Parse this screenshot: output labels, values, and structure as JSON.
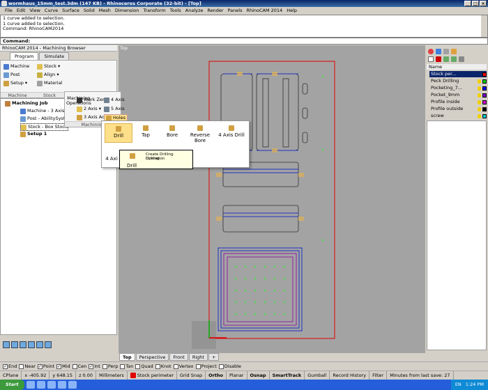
{
  "window": {
    "title": "wormhaus_15mm_test.3dm (147 KB) - Rhinoceros Corporate (32-bit) - [Top]"
  },
  "menu": [
    "File",
    "Edit",
    "View",
    "Curve",
    "Surface",
    "Solid",
    "Mesh",
    "Dimension",
    "Transform",
    "Tools",
    "Analyze",
    "Render",
    "Panels",
    "RhinoCAM 2014",
    "Help"
  ],
  "history": [
    "1 curve added to selection.",
    "1 curve added to selection.",
    "Command: RhinoCAM2014"
  ],
  "command": {
    "label": "Command:"
  },
  "browser": {
    "title": "RhinoCAM 2014 - Machining Browser",
    "tabs": [
      "Program",
      "Simulate"
    ],
    "ribbon": {
      "machine": "Machine",
      "post": "Post",
      "setup": "Setup",
      "stock": "Stock",
      "align": "Align",
      "material": "Material",
      "machining_operations": "Machining Operations",
      "work_zero": "Work Zero",
      "two_axis": "2 Axis",
      "three_axis_adv": "3 Axis Adv",
      "four_axis": "4 Axis",
      "five_axis": "5 Axis",
      "holes": "Holes",
      "group_machine_setup": "Machine Setup",
      "group_stock": "Stock",
      "group_machining": "Machining"
    },
    "tree": {
      "job": "Machining Job",
      "machine": "Machine - 3 Axis",
      "post": "Post - AbilitySyste",
      "stock": "Stock - Box Stock",
      "setup": "Setup 1"
    }
  },
  "viewport": {
    "label": "Top"
  },
  "holes_menu": {
    "items": [
      "Drill",
      "Tap",
      "Bore",
      "Reverse Bore",
      "4 Axis Drill"
    ],
    "row2_partial": "4 Axi",
    "tooltip": {
      "title": "Create Drilling Operation",
      "subtitle": "Drilling",
      "name": "Drill"
    }
  },
  "layers": {
    "header": "Name",
    "items": [
      {
        "name": "Stock per...",
        "color": "#ff0000",
        "selected": true
      },
      {
        "name": "Peck Drilling",
        "color": "#00cc00"
      },
      {
        "name": "Pocketing_7...",
        "color": "#0000ff"
      },
      {
        "name": "Pocket_9mm",
        "color": "#7700cc"
      },
      {
        "name": "Profile inside",
        "color": "#cc00cc"
      },
      {
        "name": "Profile outside",
        "color": "#000000"
      },
      {
        "name": "screw",
        "color": "#00cccc"
      }
    ]
  },
  "viewtabs": [
    "Top",
    "Perspective",
    "Front",
    "Right"
  ],
  "osnaps": [
    {
      "label": "End",
      "checked": true
    },
    {
      "label": "Near",
      "checked": false
    },
    {
      "label": "Point",
      "checked": true
    },
    {
      "label": "Mid",
      "checked": true
    },
    {
      "label": "Cen",
      "checked": false
    },
    {
      "label": "Int",
      "checked": true
    },
    {
      "label": "Perp",
      "checked": false
    },
    {
      "label": "Tan",
      "checked": false
    },
    {
      "label": "Quad",
      "checked": false
    },
    {
      "label": "Knot",
      "checked": false
    },
    {
      "label": "Vertex",
      "checked": false
    },
    {
      "label": "Project",
      "checked": false
    },
    {
      "label": "Disable",
      "checked": false
    }
  ],
  "status": {
    "cplane": "CPlane",
    "x": "x -405.92",
    "y": "y 648.15",
    "z": "z 0.00",
    "units": "Millimeters",
    "layer": "Stock perimeter",
    "grid_snap": "Grid Snap",
    "ortho": "Ortho",
    "planar": "Planar",
    "osnap": "Osnap",
    "smarttrack": "SmartTrack",
    "gumball": "Gumball",
    "record": "Record History",
    "filter": "Filter",
    "save": "Minutes from last save: 27"
  },
  "taskbar": {
    "start": "Start",
    "lang": "EN",
    "clock": "1:24 PM"
  }
}
